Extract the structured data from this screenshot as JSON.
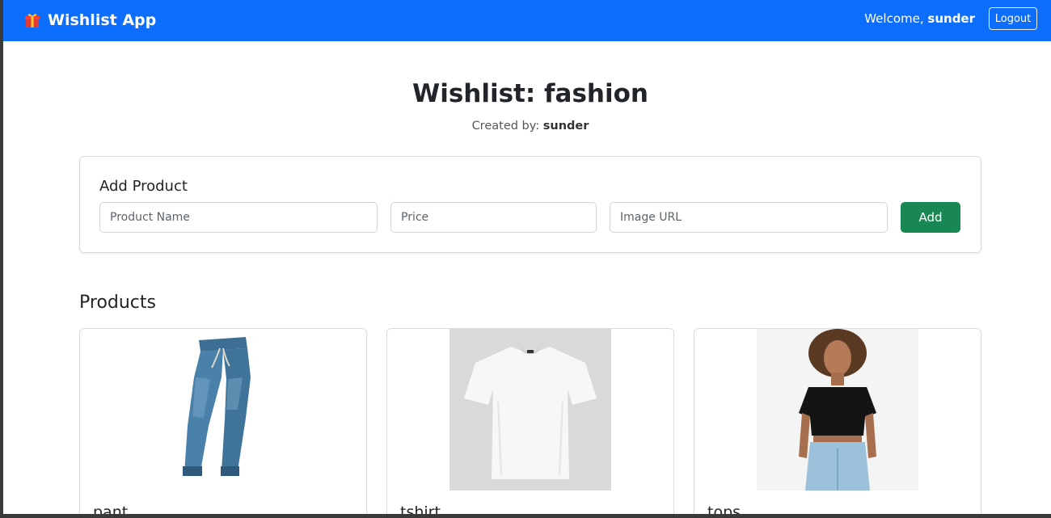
{
  "navbar": {
    "brand": "Wishlist App",
    "welcome_prefix": "Welcome,",
    "username": "sunder",
    "logout_label": "Logout",
    "color": "#0d6efd"
  },
  "header": {
    "title": "Wishlist: fashion",
    "created_by_label": "Created by:",
    "created_by_user": "sunder"
  },
  "add_product": {
    "title": "Add Product",
    "name_placeholder": "Product Name",
    "price_placeholder": "Price",
    "url_placeholder": "Image URL",
    "add_label": "Add",
    "add_color": "#198754"
  },
  "products": {
    "heading": "Products",
    "items": [
      {
        "name": "pant",
        "image": "jeans-photo"
      },
      {
        "name": "tshirt",
        "image": "white-tshirt-photo"
      },
      {
        "name": "tops",
        "image": "woman-black-crop-top-photo"
      }
    ]
  }
}
